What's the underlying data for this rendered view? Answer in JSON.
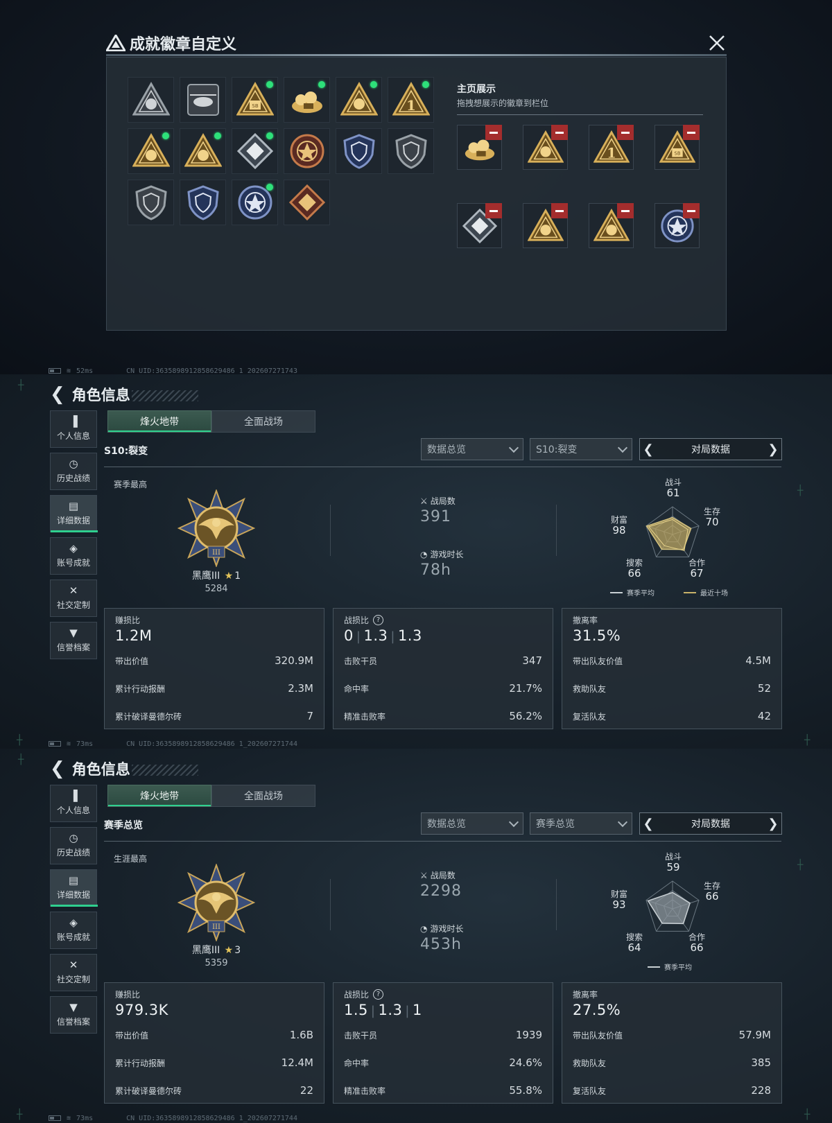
{
  "modal": {
    "title": "成就徽章自定义",
    "close_label": "×",
    "home_title": "主页展示",
    "home_subtitle": "拖拽想展示的徽章到栏位",
    "badges": [
      {
        "icon": "triangle-emblem-icon",
        "new": false,
        "style": "gray"
      },
      {
        "icon": "helicopter-badge-icon",
        "new": false,
        "style": "gray"
      },
      {
        "icon": "sb-triangle-badge-icon",
        "new": true,
        "style": "gold"
      },
      {
        "icon": "gold-pile-badge-icon",
        "new": true,
        "style": "gold"
      },
      {
        "icon": "helmet-triangle-badge-icon",
        "new": true,
        "style": "gold"
      },
      {
        "icon": "number-one-badge-icon",
        "new": true,
        "style": "gold"
      },
      {
        "icon": "hands-triangle-badge-icon",
        "new": true,
        "style": "gold"
      },
      {
        "icon": "soldier-triangle-badge-icon",
        "new": true,
        "style": "gold"
      },
      {
        "icon": "safe-diamond-badge-icon",
        "new": true,
        "style": "silver"
      },
      {
        "icon": "star-round-badge-icon",
        "new": false,
        "style": "red"
      },
      {
        "icon": "blue-shield-badge-icon",
        "new": false,
        "style": "blue"
      },
      {
        "icon": "shield-gold-badge-icon",
        "new": false,
        "style": "gray"
      },
      {
        "icon": "rifle-shield-badge-icon",
        "new": false,
        "style": "gray"
      },
      {
        "icon": "blue-wing-badge-icon",
        "new": false,
        "style": "blue"
      },
      {
        "icon": "eagle-round-badge-icon",
        "new": true,
        "style": "blue"
      },
      {
        "icon": "demon-diamond-badge-icon",
        "new": false,
        "style": "red"
      }
    ],
    "slots": [
      {
        "icon": "gold-pile-badge-icon",
        "style": "gold"
      },
      {
        "icon": "helmet-triangle-badge-icon",
        "style": "gold"
      },
      {
        "icon": "number-one-badge-icon",
        "style": "gold"
      },
      {
        "icon": "sb-triangle-badge-icon",
        "style": "gold"
      },
      {
        "icon": "safe-diamond-badge-icon",
        "style": "silver"
      },
      {
        "icon": "soldier-triangle-badge-icon",
        "style": "gold"
      },
      {
        "icon": "hands-triangle-badge-icon",
        "style": "gold"
      },
      {
        "icon": "eagle-round-badge-icon",
        "style": "blue"
      }
    ]
  },
  "status": [
    {
      "ping": "52ms",
      "uid": "CN UID:3635898912858629486 1_202607271743"
    },
    {
      "ping": "73ms",
      "uid": "CN UID:3635898912858629486 1_202607271744"
    },
    {
      "ping": "73ms",
      "uid": "CN UID:3635898912858629486 1_202607271744"
    }
  ],
  "nav": {
    "back_title": "角色信息",
    "items": [
      {
        "icon": "bar-chart-icon",
        "glyph": "▐",
        "label": "个人信息"
      },
      {
        "icon": "clock-icon",
        "glyph": "◷",
        "label": "历史战绩"
      },
      {
        "icon": "folder-icon",
        "glyph": "▤",
        "label": "详细数据"
      },
      {
        "icon": "medal-icon",
        "glyph": "◈",
        "label": "账号成就"
      },
      {
        "icon": "tools-icon",
        "glyph": "✕",
        "label": "社交定制"
      },
      {
        "icon": "shield-icon",
        "glyph": "▼",
        "label": "信誉档案"
      }
    ],
    "tabs": [
      "烽火地带",
      "全面战场"
    ]
  },
  "screens": [
    {
      "season": "S10:裂变",
      "filter1": "数据总览",
      "filter2": "S10:裂变",
      "pager": "对局数据",
      "best_label": "赛季最高",
      "rank": "黑鹰III",
      "stars": "1",
      "points": "5284",
      "matches_label": "战局数",
      "matches": "391",
      "time_label": "游戏时长",
      "time": "78h",
      "radar": {
        "labels": [
          "战斗",
          "生存",
          "合作",
          "搜索",
          "财富"
        ],
        "values": [
          61,
          70,
          67,
          66,
          98
        ],
        "recent": [
          54,
          58,
          72,
          50,
          90
        ]
      },
      "legend": [
        "赛季平均",
        "最近十场"
      ],
      "cards": [
        {
          "head": "赚损比",
          "big": "1.2M",
          "rows": [
            [
              "带出价值",
              "320.9M"
            ],
            [
              "累计行动报酬",
              "2.3M"
            ],
            [
              "累计破译曼德尔砖",
              "7"
            ]
          ]
        },
        {
          "head": "战损比",
          "big": [
            "0",
            "1.3",
            "1.3"
          ],
          "rows": [
            [
              "击败干员",
              "347"
            ],
            [
              "命中率",
              "21.7%"
            ],
            [
              "精准击败率",
              "56.2%"
            ]
          ]
        },
        {
          "head": "撤离率",
          "big": "31.5%",
          "rows": [
            [
              "带出队友价值",
              "4.5M"
            ],
            [
              "救助队友",
              "52"
            ],
            [
              "复活队友",
              "42"
            ]
          ]
        }
      ]
    },
    {
      "season": "赛季总览",
      "filter1": "数据总览",
      "filter2": "赛季总览",
      "pager": "对局数据",
      "best_label": "生涯最高",
      "rank": "黑鹰III",
      "stars": "3",
      "points": "5359",
      "matches_label": "战局数",
      "matches": "2298",
      "time_label": "游戏时长",
      "time": "453h",
      "radar": {
        "labels": [
          "战斗",
          "生存",
          "合作",
          "搜索",
          "财富"
        ],
        "values": [
          59,
          66,
          66,
          64,
          93
        ],
        "recent": null
      },
      "legend": [
        "赛季平均"
      ],
      "cards": [
        {
          "head": "赚损比",
          "big": "979.3K",
          "rows": [
            [
              "带出价值",
              "1.6B"
            ],
            [
              "累计行动报酬",
              "12.4M"
            ],
            [
              "累计破译曼德尔砖",
              "22"
            ]
          ]
        },
        {
          "head": "战损比",
          "big": [
            "1.5",
            "1.3",
            "1"
          ],
          "rows": [
            [
              "击败干员",
              "1939"
            ],
            [
              "命中率",
              "24.6%"
            ],
            [
              "精准击败率",
              "55.8%"
            ]
          ]
        },
        {
          "head": "撤离率",
          "big": "27.5%",
          "rows": [
            [
              "带出队友价值",
              "57.9M"
            ],
            [
              "救助队友",
              "385"
            ],
            [
              "复活队友",
              "228"
            ]
          ]
        }
      ]
    }
  ]
}
